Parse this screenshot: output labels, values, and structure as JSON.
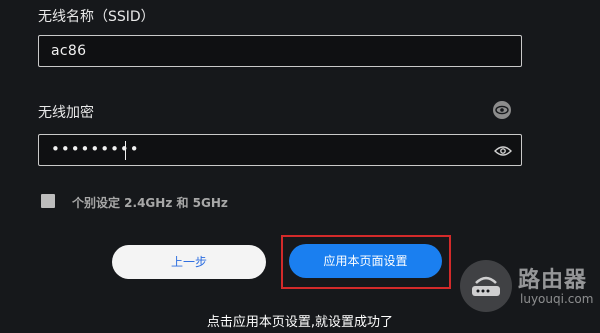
{
  "ssid": {
    "label": "无线名称（SSID）",
    "value": "ac86"
  },
  "encryption": {
    "label": "无线加密",
    "value": "•••••••••"
  },
  "separate_band": {
    "label": "个别设定 2.4GHz 和 5GHz",
    "checked": false
  },
  "buttons": {
    "back": "上一步",
    "apply": "应用本页面设置"
  },
  "caption": "点击应用本页设置,就设置成功了",
  "watermark": {
    "title": "路由器",
    "subtitle": "luyouqi.com"
  },
  "colors": {
    "background": "#16181b",
    "accent": "#1a7ff0",
    "highlight": "#d32a2a"
  }
}
